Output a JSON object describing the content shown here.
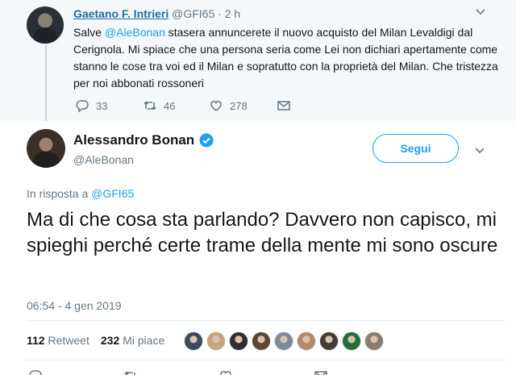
{
  "parent_tweet": {
    "name": "Gaetano F. Intrieri",
    "handle": "@GFI65",
    "separator": "·",
    "time": "2 h",
    "text_before": "Salve ",
    "text_mention": "@AleBonan",
    "text_after": " stasera annuncerete il nuovo acquisto del Milan Levaldigi dal Cerignola. Mi spiace che una persona seria come Lei non dichiari apertamente come stanno le cose tra voi ed il Milan e sopratutto con la proprietà del Milan. Che tristezza per noi abbonati rossoneri",
    "replies": "33",
    "retweets": "46",
    "likes": "278"
  },
  "tweet": {
    "name": "Alessandro Bonan",
    "handle": "@AleBonan",
    "follow_label": "Segui",
    "reply_prefix": "In risposta a ",
    "reply_handle": "@GFI65",
    "text": "Ma di che cosa sta parlando? Davvero non capisco, mi spieghi perché certe trame della mente mi sono oscure",
    "timestamp": "06:54 - 4 gen 2019",
    "retweet_count": "112",
    "retweet_label": "Retweet",
    "like_count": "232",
    "like_label": "Mi piace"
  },
  "colors": {
    "accent": "#1da1f2",
    "muted": "#657786",
    "parent_bg": "#f5f8fa"
  },
  "likers": [
    "#3b4a5c",
    "#c9a27e",
    "#2e2e2e",
    "#5a4636",
    "#7d8b99",
    "#b08a6a",
    "#4a3b30",
    "#1f6f3a",
    "#8c7b70"
  ]
}
